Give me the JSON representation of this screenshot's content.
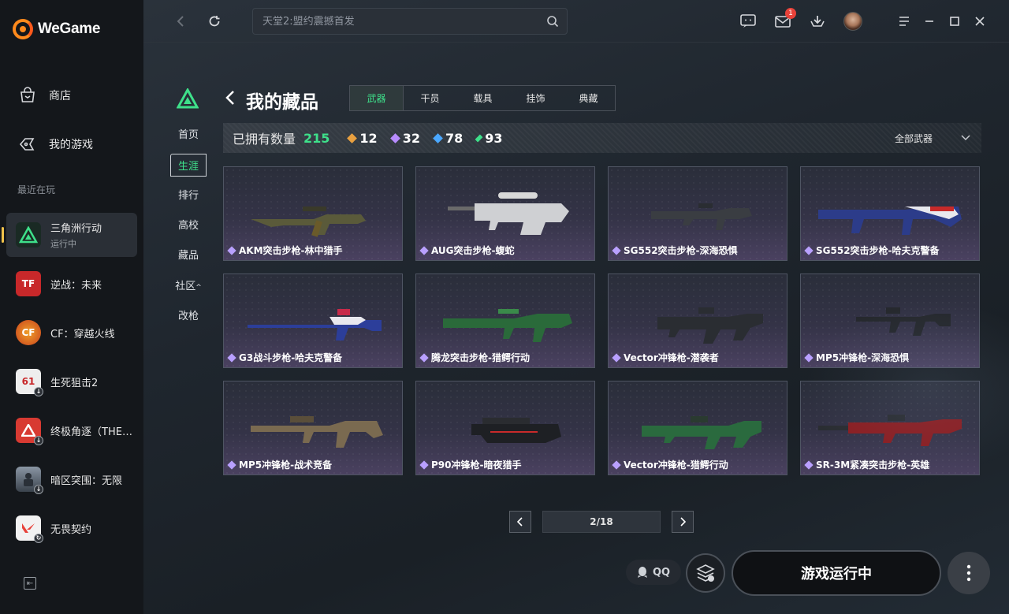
{
  "app": {
    "logo_text": "WeGame"
  },
  "sidebar": {
    "nav": [
      {
        "label": "商店",
        "icon": "shop-bag-icon"
      },
      {
        "label": "我的游戏",
        "icon": "gamepad-icon"
      }
    ],
    "recent_title": "最近在玩",
    "games": [
      {
        "name": "三角洲行动",
        "status": "运行中",
        "icon_color": "#1a3a2a"
      },
      {
        "name": "逆战：未来",
        "icon_color": "#c8282a"
      },
      {
        "name": "CF：穿越火线",
        "icon_color": "#d0541c"
      },
      {
        "name": "生死狙击2",
        "icon_color": "#e8e8e8"
      },
      {
        "name": "终极角逐（THE FINALS）",
        "icon_color": "#d83a32"
      },
      {
        "name": "暗区突围：无限",
        "icon_color": "#5a6470"
      },
      {
        "name": "无畏契约",
        "icon_color": "#e8e8e8"
      }
    ]
  },
  "topbar": {
    "search_placeholder": "天堂2:盟约震撼首发",
    "mail_badge": "1"
  },
  "panel": {
    "title": "我的藏品",
    "tabs": [
      "武器",
      "干员",
      "载具",
      "挂饰",
      "典藏"
    ],
    "active_tab": 0,
    "subnav": [
      "首页",
      "生涯",
      "排行",
      "高校",
      "藏品",
      "社区",
      "改枪"
    ],
    "subnav_community_suffix": "^",
    "owned_label": "已拥有数量",
    "owned_total": "215",
    "stats": [
      {
        "value": "12",
        "color": "#e8a040"
      },
      {
        "value": "32",
        "color": "#b88cff"
      },
      {
        "value": "78",
        "color": "#4aa8ff"
      },
      {
        "value": "93",
        "color": "#3ee08a"
      }
    ],
    "filter_label": "全部武器",
    "items": [
      "AKM突击步枪-林中猎手",
      "AUG突击步枪-蝮蛇",
      "SG552突击步枪-深海恐惧",
      "SG552突击步枪-哈夫克警备",
      "G3战斗步枪-哈夫克警备",
      "腾龙突击步枪-猎鳄行动",
      "Vector冲锋枪-潜袭者",
      "MP5冲锋枪-深海恐惧",
      "MP5冲锋枪-战术竞备",
      "P90冲锋枪-暗夜猎手",
      "Vector冲锋枪-猎鳄行动",
      "SR-3M紧凑突击步枪-英雄"
    ],
    "page_indicator": "2/18"
  },
  "footer": {
    "qq_label": "QQ",
    "run_label": "游戏运行中"
  }
}
